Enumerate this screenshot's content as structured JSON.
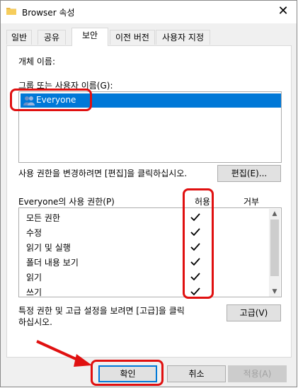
{
  "window": {
    "title": "Browser 속성"
  },
  "tabs": [
    {
      "label": "일반"
    },
    {
      "label": "공유"
    },
    {
      "label": "보안"
    },
    {
      "label": "이전 버전"
    },
    {
      "label": "사용자 지정"
    }
  ],
  "security": {
    "object_name_label": "개체 이름:",
    "group_label": "그룹 또는 사용자 이름(G):",
    "users": [
      {
        "name": "Everyone",
        "selected": true
      }
    ],
    "change_hint": "사용 권한을 변경하려면 [편집]을 클릭하십시오.",
    "edit_button": "편집(E)...",
    "perm_header": "Everyone의 사용 권한(P)",
    "allow_header": "허용",
    "deny_header": "거부",
    "permissions": [
      {
        "name": "모든 권한",
        "allow": true,
        "deny": false
      },
      {
        "name": "수정",
        "allow": true,
        "deny": false
      },
      {
        "name": "읽기 및 실행",
        "allow": true,
        "deny": false
      },
      {
        "name": "폴더 내용 보기",
        "allow": true,
        "deny": false
      },
      {
        "name": "읽기",
        "allow": true,
        "deny": false
      },
      {
        "name": "쓰기",
        "allow": true,
        "deny": false
      }
    ],
    "advanced_hint_line1": "특정 권한 및 고급 설정을 보려면 [고급]을 클릭",
    "advanced_hint_line2": "하십시오.",
    "advanced_button": "고급(V)"
  },
  "footer": {
    "ok": "확인",
    "cancel": "취소",
    "apply": "적용(A)"
  },
  "colors": {
    "selection": "#0078d7",
    "annotation": "#e01010"
  }
}
